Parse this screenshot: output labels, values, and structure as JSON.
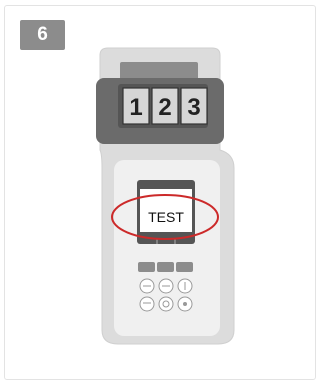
{
  "step": {
    "number": "6"
  },
  "device": {
    "chamber_digits": [
      "1",
      "2",
      "3"
    ],
    "screen_text": "TEST",
    "colors": {
      "body": "#dcdcdc",
      "chamber": "#6b6b6b",
      "chamber_top": "#8c8c8c",
      "screen_frame": "#555555",
      "highlight_ring": "#cc2a2a",
      "accent_buttons": "#8c8c8c"
    }
  }
}
